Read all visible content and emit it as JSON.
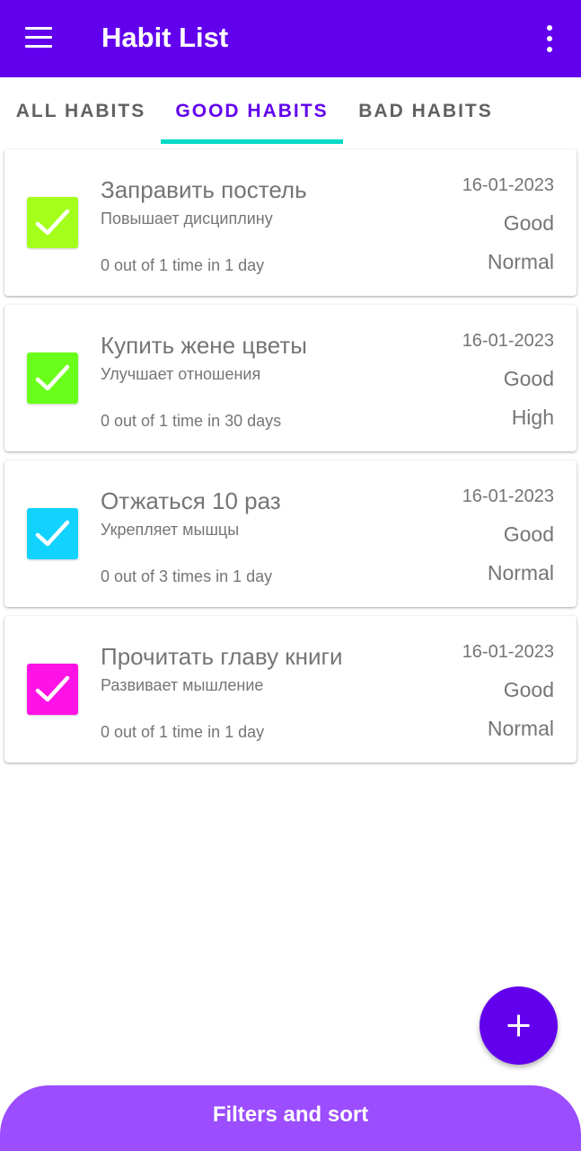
{
  "app_bar": {
    "title": "Habit List",
    "menu_icon": "hamburger-menu-icon",
    "overflow_icon": "more-vert-icon",
    "color": "#6200ee"
  },
  "tabs": [
    {
      "label": "ALL HABITS",
      "active": false
    },
    {
      "label": "GOOD HABITS",
      "active": true
    },
    {
      "label": "BAD HABITS",
      "active": false
    }
  ],
  "tab_indicator_color": "#03dac5",
  "habits": [
    {
      "name": "Заправить постель",
      "description": "Повышает дисциплину",
      "frequency": "0 out of 1 time in 1 day",
      "date": "16-01-2023",
      "type": "Good",
      "priority": "Normal",
      "color": "#a4ff1a",
      "icon": "check-icon"
    },
    {
      "name": "Купить жене цветы",
      "description": "Улучшает отношения",
      "frequency": "0 out of 1 time in 30 days",
      "date": "16-01-2023",
      "type": "Good",
      "priority": "High",
      "color": "#69ff1a",
      "icon": "check-icon"
    },
    {
      "name": "Отжаться 10 раз",
      "description": "Укрепляет мышцы",
      "frequency": "0 out of 3 times in 1 day",
      "date": "16-01-2023",
      "type": "Good",
      "priority": "Normal",
      "color": "#12d3ff",
      "icon": "check-icon"
    },
    {
      "name": "Прочитать главу книги",
      "description": "Развивает мышление",
      "frequency": "0 out of 1 time in 1 day",
      "date": "16-01-2023",
      "type": "Good",
      "priority": "Normal",
      "color": "#ff12e5",
      "icon": "check-icon"
    }
  ],
  "fab": {
    "icon": "plus-icon",
    "color": "#6200ee"
  },
  "bottom_sheet": {
    "label": "Filters and sort",
    "color": "#9b4dff"
  }
}
